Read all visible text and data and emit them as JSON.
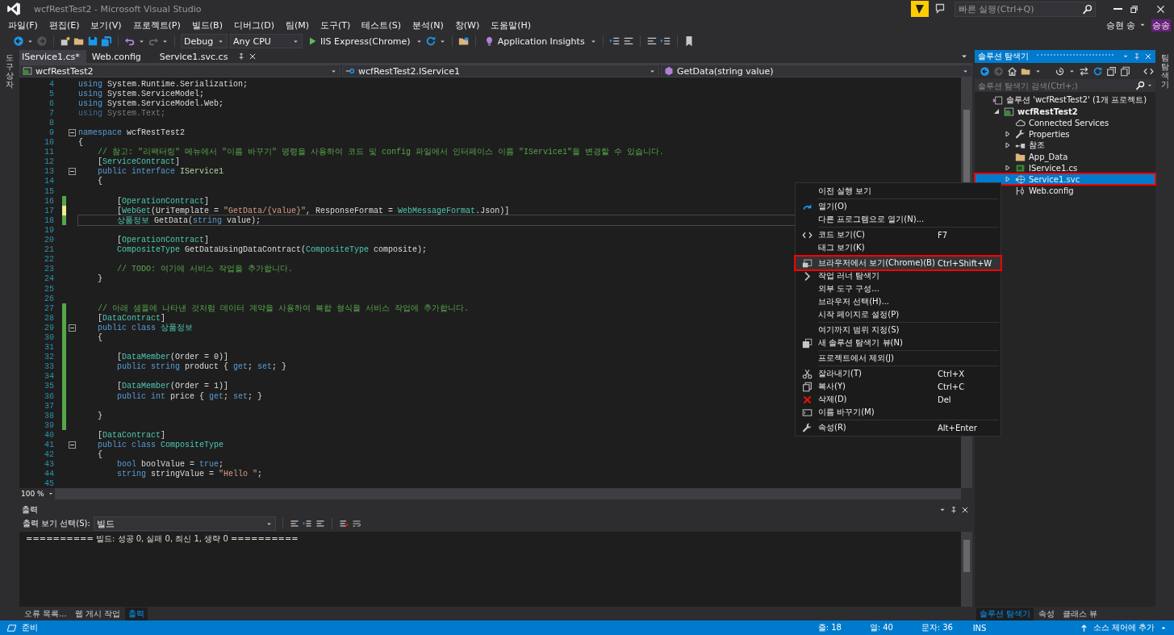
{
  "window": {
    "title": "wcfRestTest2 - Microsoft Visual Studio",
    "quick_launch": {
      "placeholder": "빠른 실행(Ctrl+Q)"
    }
  },
  "menu": [
    "파일(F)",
    "편집(E)",
    "보기(V)",
    "프로젝트(P)",
    "빌드(B)",
    "디버그(D)",
    "팀(M)",
    "도구(T)",
    "테스트(S)",
    "분석(N)",
    "창(W)",
    "도움말(H)"
  ],
  "account": {
    "name": "승현 송",
    "initials": "승송"
  },
  "toolbar": {
    "configuration": "Debug",
    "platform": "Any CPU",
    "run_target": "IIS Express(Chrome)",
    "insights": "Application Insights"
  },
  "left_side_tab": "도구 상자",
  "right_side_tab": "팀 탐색기",
  "doc_tabs": [
    {
      "label": "IService1.cs*",
      "selected": true
    },
    {
      "label": "Web.config",
      "selected": false
    },
    {
      "label": "Service1.svc.cs",
      "selected": false
    }
  ],
  "nav_bar": {
    "project": "wcfRestTest2",
    "type": "wcfRestTest2.IService1",
    "member": "GetData(string value)"
  },
  "code_lines": [
    {
      "n": "4",
      "fold": false,
      "changed": false,
      "current": false,
      "tokens": [
        {
          "kind": "keyword",
          "text": "using"
        },
        {
          "kind": "plain",
          "text": " System.Runtime.Serialization;"
        }
      ]
    },
    {
      "n": "5",
      "fold": false,
      "changed": false,
      "current": false,
      "tokens": [
        {
          "kind": "keyword",
          "text": "using"
        },
        {
          "kind": "plain",
          "text": " System.ServiceModel;"
        }
      ]
    },
    {
      "n": "6",
      "fold": false,
      "changed": false,
      "current": false,
      "tokens": [
        {
          "kind": "keyword",
          "text": "using"
        },
        {
          "kind": "plain",
          "text": " System.ServiceModel.Web;"
        }
      ]
    },
    {
      "n": "7",
      "fold": false,
      "changed": false,
      "current": false,
      "tokens": [
        {
          "kind": "dimkeyword",
          "text": "using"
        },
        {
          "kind": "dim",
          "text": " System.Text;"
        }
      ]
    },
    {
      "n": "8",
      "fold": false,
      "changed": false,
      "current": false
    },
    {
      "n": "9",
      "fold": true,
      "changed": false,
      "current": false,
      "tokens": [
        {
          "kind": "keyword",
          "text": "namespace"
        },
        {
          "kind": "plain",
          "text": " wcfRestTest2"
        }
      ]
    },
    {
      "n": "10",
      "fold": false,
      "changed": false,
      "current": false,
      "tokens": [
        {
          "kind": "plain",
          "text": "{"
        }
      ]
    },
    {
      "n": "11",
      "fold": false,
      "changed": false,
      "current": false,
      "tokens": [
        {
          "kind": "comment",
          "text": "    // 참고: \"리팩터링\" 메뉴에서 \"이름 바꾸기\" 명령을 사용하여 코드 및 config 파일에서 인터페이스 이름 \"IService1\"을 변경할 수 있습니다."
        }
      ]
    },
    {
      "n": "12",
      "fold": false,
      "changed": false,
      "current": false,
      "tokens": [
        {
          "kind": "plain",
          "text": "    ["
        },
        {
          "kind": "type",
          "text": "ServiceContract"
        },
        {
          "kind": "plain",
          "text": "]"
        }
      ]
    },
    {
      "n": "13",
      "fold": true,
      "changed": false,
      "current": false,
      "tokens": [
        {
          "kind": "keyword",
          "text": "    public interface"
        },
        {
          "kind": "interface",
          "text": " IService1"
        }
      ]
    },
    {
      "n": "14",
      "fold": false,
      "changed": false,
      "current": false,
      "tokens": [
        {
          "kind": "plain",
          "text": "    {"
        }
      ]
    },
    {
      "n": "15",
      "fold": false,
      "changed": false,
      "current": false
    },
    {
      "n": "16",
      "fold": false,
      "changed": true,
      "unsaved": false,
      "current": false,
      "tokens": [
        {
          "kind": "plain",
          "text": "        ["
        },
        {
          "kind": "type",
          "text": "OperationContract"
        },
        {
          "kind": "plain",
          "text": "]"
        }
      ]
    },
    {
      "n": "17",
      "fold": false,
      "changed": true,
      "unsaved": true,
      "current": false,
      "tokens": [
        {
          "kind": "plain",
          "text": "        ["
        },
        {
          "kind": "type",
          "text": "WebGet"
        },
        {
          "kind": "plain",
          "text": "(UriTemplate = "
        },
        {
          "kind": "string",
          "text": "\"GetData/{value}\""
        },
        {
          "kind": "plain",
          "text": ", ResponseFormat = "
        },
        {
          "kind": "type",
          "text": "WebMessageFormat"
        },
        {
          "kind": "plain",
          "text": ".Json)]"
        }
      ]
    },
    {
      "n": "18",
      "fold": false,
      "changed": true,
      "unsaved": false,
      "current": true,
      "tokens": [
        {
          "kind": "type",
          "text": "        상품정보"
        },
        {
          "kind": "plain",
          "text": " GetData("
        },
        {
          "kind": "keyword",
          "text": "string"
        },
        {
          "kind": "plain",
          "text": " value);"
        }
      ]
    },
    {
      "n": "19",
      "fold": false,
      "changed": false,
      "current": false
    },
    {
      "n": "20",
      "fold": false,
      "changed": false,
      "current": false,
      "tokens": [
        {
          "kind": "plain",
          "text": "        ["
        },
        {
          "kind": "type",
          "text": "OperationContract"
        },
        {
          "kind": "plain",
          "text": "]"
        }
      ]
    },
    {
      "n": "21",
      "fold": false,
      "changed": false,
      "current": false,
      "tokens": [
        {
          "kind": "type",
          "text": "        CompositeType"
        },
        {
          "kind": "plain",
          "text": " GetDataUsingDataContract("
        },
        {
          "kind": "type",
          "text": "CompositeType"
        },
        {
          "kind": "plain",
          "text": " composite);"
        }
      ]
    },
    {
      "n": "22",
      "fold": false,
      "changed": false,
      "current": false
    },
    {
      "n": "23",
      "fold": false,
      "changed": false,
      "current": false,
      "tokens": [
        {
          "kind": "comment",
          "text": "        // TODO: 여기에 서비스 작업을 추가합니다."
        }
      ]
    },
    {
      "n": "24",
      "fold": false,
      "changed": false,
      "current": false,
      "tokens": [
        {
          "kind": "plain",
          "text": "    }"
        }
      ]
    },
    {
      "n": "25",
      "fold": false,
      "changed": false,
      "current": false
    },
    {
      "n": "26",
      "fold": false,
      "changed": false,
      "current": false
    },
    {
      "n": "27",
      "fold": false,
      "changed": true,
      "unsaved": false,
      "current": false,
      "tokens": [
        {
          "kind": "comment",
          "text": "    // 아래 샘플에 나타낸 것처럼 데이터 계약을 사용하여 복합 형식을 서비스 작업에 추가합니다."
        }
      ]
    },
    {
      "n": "28",
      "fold": false,
      "changed": true,
      "unsaved": false,
      "current": false,
      "tokens": [
        {
          "kind": "plain",
          "text": "    ["
        },
        {
          "kind": "type",
          "text": "DataContract"
        },
        {
          "kind": "plain",
          "text": "]"
        }
      ]
    },
    {
      "n": "29",
      "fold": true,
      "changed": true,
      "unsaved": false,
      "current": false,
      "tokens": [
        {
          "kind": "keyword",
          "text": "    public class"
        },
        {
          "kind": "type",
          "text": " 상품정보"
        }
      ]
    },
    {
      "n": "30",
      "fold": false,
      "changed": true,
      "unsaved": false,
      "current": false,
      "tokens": [
        {
          "kind": "plain",
          "text": "    {"
        }
      ]
    },
    {
      "n": "31",
      "fold": false,
      "changed": true,
      "unsaved": false,
      "current": false
    },
    {
      "n": "32",
      "fold": false,
      "changed": true,
      "unsaved": false,
      "current": false,
      "tokens": [
        {
          "kind": "plain",
          "text": "        ["
        },
        {
          "kind": "type",
          "text": "DataMember"
        },
        {
          "kind": "plain",
          "text": "(Order = 0)]"
        }
      ]
    },
    {
      "n": "33",
      "fold": false,
      "changed": true,
      "unsaved": false,
      "current": false,
      "tokens": [
        {
          "kind": "keyword",
          "text": "        public string"
        },
        {
          "kind": "plain",
          "text": " product { "
        },
        {
          "kind": "keyword",
          "text": "get"
        },
        {
          "kind": "plain",
          "text": "; "
        },
        {
          "kind": "keyword",
          "text": "set"
        },
        {
          "kind": "plain",
          "text": "; }"
        }
      ]
    },
    {
      "n": "34",
      "fold": false,
      "changed": true,
      "unsaved": false,
      "current": false
    },
    {
      "n": "35",
      "fold": false,
      "changed": true,
      "unsaved": false,
      "current": false,
      "tokens": [
        {
          "kind": "plain",
          "text": "        ["
        },
        {
          "kind": "type",
          "text": "DataMember"
        },
        {
          "kind": "plain",
          "text": "(Order = 1)]"
        }
      ]
    },
    {
      "n": "36",
      "fold": false,
      "changed": true,
      "unsaved": false,
      "current": false,
      "tokens": [
        {
          "kind": "keyword",
          "text": "        public int"
        },
        {
          "kind": "plain",
          "text": " price { "
        },
        {
          "kind": "keyword",
          "text": "get"
        },
        {
          "kind": "plain",
          "text": "; "
        },
        {
          "kind": "keyword",
          "text": "set"
        },
        {
          "kind": "plain",
          "text": "; }"
        }
      ]
    },
    {
      "n": "37",
      "fold": false,
      "changed": true,
      "unsaved": false,
      "current": false
    },
    {
      "n": "38",
      "fold": false,
      "changed": true,
      "unsaved": false,
      "current": false,
      "tokens": [
        {
          "kind": "plain",
          "text": "    }"
        }
      ]
    },
    {
      "n": "39",
      "fold": false,
      "changed": true,
      "unsaved": false,
      "current": false
    },
    {
      "n": "40",
      "fold": false,
      "changed": false,
      "current": false,
      "tokens": [
        {
          "kind": "plain",
          "text": "    ["
        },
        {
          "kind": "type",
          "text": "DataContract"
        },
        {
          "kind": "plain",
          "text": "]"
        }
      ]
    },
    {
      "n": "41",
      "fold": true,
      "changed": false,
      "current": false,
      "tokens": [
        {
          "kind": "keyword",
          "text": "    public class"
        },
        {
          "kind": "type",
          "text": " CompositeType"
        }
      ]
    },
    {
      "n": "42",
      "fold": false,
      "changed": false,
      "current": false,
      "tokens": [
        {
          "kind": "plain",
          "text": "    {"
        }
      ]
    },
    {
      "n": "43",
      "fold": false,
      "changed": false,
      "current": false,
      "tokens": [
        {
          "kind": "keyword",
          "text": "        bool"
        },
        {
          "kind": "plain",
          "text": " boolValue = "
        },
        {
          "kind": "keyword",
          "text": "true"
        },
        {
          "kind": "plain",
          "text": ";"
        }
      ]
    },
    {
      "n": "44",
      "fold": false,
      "changed": false,
      "current": false,
      "tokens": [
        {
          "kind": "keyword",
          "text": "        string"
        },
        {
          "kind": "plain",
          "text": " stringValue = "
        },
        {
          "kind": "string",
          "text": "\"Hello \""
        },
        {
          "kind": "plain",
          "text": ";"
        }
      ]
    },
    {
      "n": "45",
      "fold": false,
      "changed": false,
      "current": false
    }
  ],
  "zoom": "100 %",
  "output": {
    "title": "출력",
    "source_label": "출력 보기 선택(S):",
    "source": "빌드",
    "text": "========== 빌드: 성공 0, 실패 0, 최신 1, 생략 0 =========="
  },
  "bottom_tabs": [
    {
      "label": "오류 목록...",
      "selected": false
    },
    {
      "label": "웹 게시 작업",
      "selected": false
    },
    {
      "label": "출력",
      "selected": true
    }
  ],
  "solution_explorer": {
    "title": "솔루션 탐색기",
    "search": {
      "placeholder": "솔루션 탐색기 검색(Ctrl+;)"
    },
    "tree": [
      {
        "label": "솔루션 'wcfRestTest2' (1개 프로젝트)",
        "kind": "solution",
        "bold": false,
        "selected": false,
        "highlighted": false,
        "children": [
          {
            "label": "wcfRestTest2",
            "kind": "project",
            "expanded": true,
            "bold": true,
            "selected": false,
            "highlighted": false,
            "children": [
              {
                "label": "Connected Services",
                "kind": "cloud",
                "bold": false,
                "selected": false,
                "highlighted": false
              },
              {
                "label": "Properties",
                "kind": "wrench",
                "expanded": false,
                "bold": false,
                "selected": false,
                "highlighted": false
              },
              {
                "label": "참조",
                "kind": "refs",
                "expanded": false,
                "bold": false,
                "selected": false,
                "highlighted": false
              },
              {
                "label": "App_Data",
                "kind": "folder",
                "bold": false,
                "selected": false,
                "highlighted": false
              },
              {
                "label": "IService1.cs",
                "kind": "cs",
                "expanded": false,
                "bold": false,
                "selected": false,
                "highlighted": false
              },
              {
                "label": "Service1.svc",
                "kind": "svc",
                "expanded": false,
                "bold": false,
                "selected": true,
                "highlighted": true
              },
              {
                "label": "Web.config",
                "kind": "config",
                "bold": false,
                "selected": false,
                "highlighted": false
              }
            ]
          }
        ]
      }
    ],
    "tabs": [
      {
        "label": "솔루션 탐색기",
        "selected": true
      },
      {
        "label": "속성",
        "selected": false
      },
      {
        "label": "클래스 뷰",
        "selected": false
      }
    ]
  },
  "context_menu": [
    [
      {
        "label": "이전 실행 보기",
        "kind": "none",
        "highlighted": false
      }
    ],
    [
      {
        "label": "열기(O)",
        "kind": "open",
        "highlighted": false
      },
      {
        "label": "다른 프로그램으로 열기(N)...",
        "kind": "none",
        "highlighted": false
      }
    ],
    [
      {
        "label": "코드 보기(C)",
        "kind": "code",
        "shortcut": "F7",
        "highlighted": false
      },
      {
        "label": "태그 보기(K)",
        "kind": "none",
        "highlighted": false
      }
    ],
    [
      {
        "label": "브라우저에서 보기(Chrome)(B)",
        "kind": "browser",
        "shortcut": "Ctrl+Shift+W",
        "highlighted": true
      },
      {
        "label": "작업 러너 탐색기",
        "kind": "chevron",
        "highlighted": false
      },
      {
        "label": "외부 도구 구성...",
        "kind": "none",
        "highlighted": false
      },
      {
        "label": "브라우저 선택(H)...",
        "kind": "none",
        "highlighted": false
      },
      {
        "label": "시작 페이지로 설정(P)",
        "kind": "none",
        "highlighted": false
      }
    ],
    [
      {
        "label": "여기까지 범위 지정(S)",
        "kind": "none",
        "highlighted": false
      },
      {
        "label": "새 솔루션 탐색기 뷰(N)",
        "kind": "newview",
        "highlighted": false
      }
    ],
    [
      {
        "label": "프로젝트에서 제외(J)",
        "kind": "none",
        "highlighted": false
      }
    ],
    [
      {
        "label": "잘라내기(T)",
        "kind": "cut",
        "shortcut": "Ctrl+X",
        "highlighted": false
      },
      {
        "label": "복사(Y)",
        "kind": "copy",
        "shortcut": "Ctrl+C",
        "highlighted": false
      },
      {
        "label": "삭제(D)",
        "kind": "delete",
        "shortcut": "Del",
        "highlighted": false
      },
      {
        "label": "이름 바꾸기(M)",
        "kind": "rename",
        "highlighted": false
      }
    ],
    [
      {
        "label": "속성(R)",
        "kind": "wrench",
        "shortcut": "Alt+Enter",
        "highlighted": false
      }
    ]
  ],
  "status_bar": {
    "state": "준비",
    "line": "줄: 18",
    "col": "열: 40",
    "char": "문자: 36",
    "mode": "INS",
    "source_control": "소스 제어에 추가"
  }
}
